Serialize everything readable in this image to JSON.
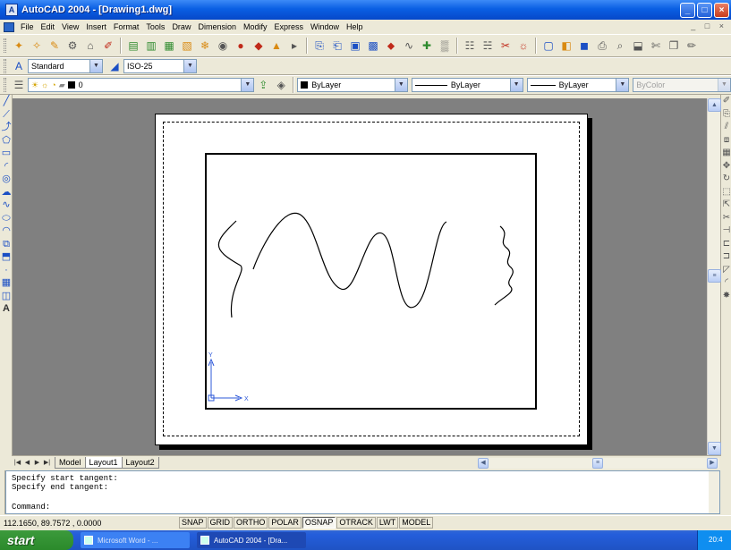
{
  "window": {
    "title": "AutoCAD 2004 - [Drawing1.dwg]",
    "icon": "autocad-app-icon"
  },
  "menu": [
    "File",
    "Edit",
    "View",
    "Insert",
    "Format",
    "Tools",
    "Draw",
    "Dimension",
    "Modify",
    "Express",
    "Window",
    "Help"
  ],
  "styles": {
    "text_style": "Standard",
    "dim_style": "ISO-25"
  },
  "layers": {
    "current": "0",
    "color": "ByLayer",
    "linetype": "ByLayer",
    "lineweight": "ByLayer",
    "plotstyle": "ByColor"
  },
  "tabs": [
    "Model",
    "Layout1",
    "Layout2"
  ],
  "active_tab": "Layout1",
  "ucs": {
    "x_label": "X",
    "y_label": "Y"
  },
  "command": {
    "lines": [
      "Specify start tangent:",
      "Specify end tangent:"
    ],
    "prompt": "Command:"
  },
  "status": {
    "coords": "112.1650, 89.7572 , 0.0000",
    "buttons": [
      {
        "label": "SNAP",
        "on": false
      },
      {
        "label": "GRID",
        "on": false
      },
      {
        "label": "ORTHO",
        "on": false
      },
      {
        "label": "POLAR",
        "on": false
      },
      {
        "label": "OSNAP",
        "on": true
      },
      {
        "label": "OTRACK",
        "on": false
      },
      {
        "label": "LWT",
        "on": false
      },
      {
        "label": "MODEL",
        "on": false
      }
    ]
  },
  "taskbar": {
    "start_label": "start",
    "tasks": [
      {
        "label": "Microsoft Word - ...",
        "active": false
      },
      {
        "label": "AutoCAD 2004 - [Dra...",
        "active": true
      }
    ],
    "clock": "20:4"
  }
}
